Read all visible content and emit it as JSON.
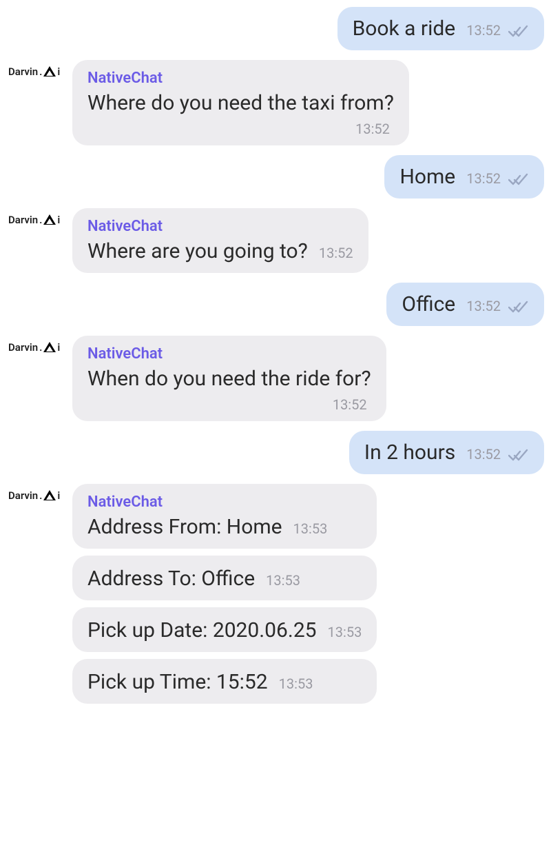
{
  "avatar": {
    "part1": "Darvin",
    "part2": "i"
  },
  "botName": "NativeChat",
  "messages": {
    "m0": {
      "text": "Book a ride",
      "time": "13:52"
    },
    "m1": {
      "text": "Where do you need the taxi from?",
      "time": "13:52"
    },
    "m2": {
      "text": "Home",
      "time": "13:52"
    },
    "m3": {
      "text": "Where are you going to?",
      "time": "13:52"
    },
    "m4": {
      "text": "Office",
      "time": "13:52"
    },
    "m5": {
      "text": "When do you need the ride for?",
      "time": "13:52"
    },
    "m6": {
      "text": "In 2 hours",
      "time": "13:52"
    },
    "m7": {
      "text": "Address From: Home",
      "time": "13:53"
    },
    "m8": {
      "text": "Address To: Office",
      "time": "13:53"
    },
    "m9": {
      "text": "Pick up Date: 2020.06.25",
      "time": "13:53"
    },
    "m10": {
      "text": "Pick up Time: 15:52",
      "time": "13:53"
    }
  }
}
